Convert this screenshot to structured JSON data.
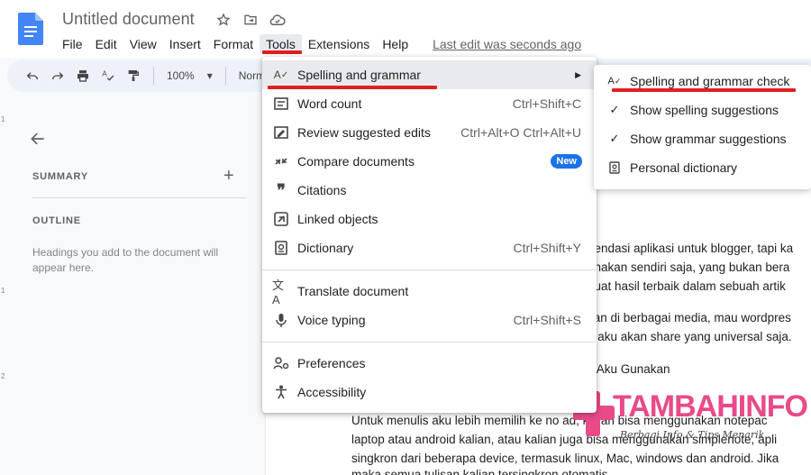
{
  "header": {
    "title": "Untitled document",
    "menus": [
      "File",
      "Edit",
      "View",
      "Insert",
      "Format",
      "Tools",
      "Extensions",
      "Help"
    ],
    "active_menu_index": 5,
    "last_edit": "Last edit was seconds ago"
  },
  "toolbar": {
    "zoom": "100%",
    "style": "Normal"
  },
  "outline_panel": {
    "summary_label": "SUMMARY",
    "outline_label": "OUTLINE",
    "help_text": "Headings you add to the document will appear here."
  },
  "ruler_ticks": [
    "1",
    "1",
    "2"
  ],
  "document": {
    "lines": [
      "nendasi aplikasi untuk blogger, tapi ka",
      "unakan sendiri saja, yang bukan bera",
      "buat hasil terbaik dalam sebuah artik",
      "kan di berbagai media, mau wordpres",
      "a aku akan share yang universal saja.",
      "k Aku Gunakan",
      "Untuk menulis aku lebih memilih ke no    ad, kalian bisa menggunakan notepac",
      "laptop atau android kalian, atau kalian juga bisa menggunakan simplenote, apli",
      "singkron dari beberapa device, termasuk linux, Mac, windows dan android. Jika",
      "maka semua tulisan kalian tersingkron otomatis."
    ]
  },
  "tools_menu": {
    "items": [
      {
        "icon": "spellcheck-icon",
        "label": "Spelling and grammar",
        "shortcut": "",
        "submenu": true
      },
      {
        "icon": "word-count-icon",
        "label": "Word count",
        "shortcut": "Ctrl+Shift+C"
      },
      {
        "icon": "review-edits-icon",
        "label": "Review suggested edits",
        "shortcut": "Ctrl+Alt+O Ctrl+Alt+U"
      },
      {
        "icon": "compare-icon",
        "label": "Compare documents",
        "badge": "New"
      },
      {
        "icon": "quote-icon",
        "label": "Citations",
        "shortcut": ""
      },
      {
        "icon": "linked-objects-icon",
        "label": "Linked objects",
        "shortcut": ""
      },
      {
        "icon": "dictionary-icon",
        "label": "Dictionary",
        "shortcut": "Ctrl+Shift+Y"
      },
      {
        "icon": "translate-icon",
        "label": "Translate document",
        "shortcut": ""
      },
      {
        "icon": "microphone-icon",
        "label": "Voice typing",
        "shortcut": "Ctrl+Shift+S"
      },
      {
        "icon": "preferences-icon",
        "label": "Preferences",
        "shortcut": ""
      },
      {
        "icon": "accessibility-icon",
        "label": "Accessibility",
        "shortcut": ""
      }
    ]
  },
  "spelling_submenu": {
    "items": [
      {
        "icon": "spellcheck-icon",
        "label": "Spelling and grammar check"
      },
      {
        "icon": "checkmark-icon",
        "label": "Show spelling suggestions",
        "checked": true
      },
      {
        "icon": "checkmark-icon",
        "label": "Show grammar suggestions",
        "checked": true
      },
      {
        "icon": "personal-dictionary-icon",
        "label": "Personal dictionary"
      }
    ]
  },
  "watermark": {
    "brand": "TAMBAHINFO",
    "tagline": "Berbagi Info & Tips Menarik"
  },
  "colors": {
    "accent_blue": "#1a73e8",
    "annotation_red": "#e02020",
    "watermark_pink": "#e84a8a"
  }
}
